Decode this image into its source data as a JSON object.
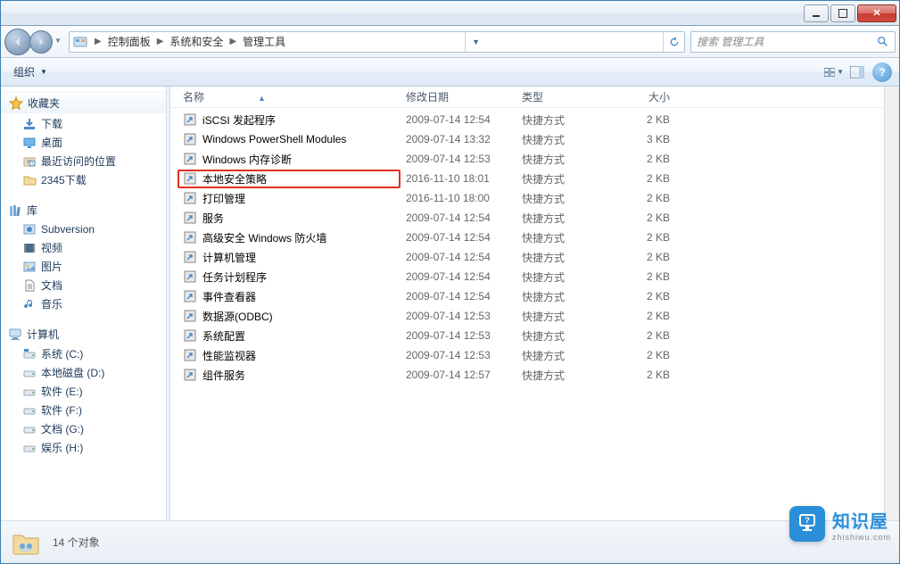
{
  "breadcrumb": {
    "items": [
      "控制面板",
      "系统和安全",
      "管理工具"
    ]
  },
  "search": {
    "placeholder": "搜索 管理工具"
  },
  "toolbar": {
    "organize": "组织"
  },
  "sidebar": {
    "favorites": {
      "label": "收藏夹",
      "items": [
        {
          "label": "下载",
          "icon": "download"
        },
        {
          "label": "桌面",
          "icon": "desktop"
        },
        {
          "label": "最近访问的位置",
          "icon": "recent"
        },
        {
          "label": "2345下载",
          "icon": "folder"
        }
      ]
    },
    "libraries": {
      "label": "库",
      "items": [
        {
          "label": "Subversion",
          "icon": "svn"
        },
        {
          "label": "视频",
          "icon": "video"
        },
        {
          "label": "图片",
          "icon": "picture"
        },
        {
          "label": "文档",
          "icon": "document"
        },
        {
          "label": "音乐",
          "icon": "music"
        }
      ]
    },
    "computer": {
      "label": "计算机",
      "items": [
        {
          "label": "系统 (C:)",
          "icon": "sysdrive"
        },
        {
          "label": "本地磁盘 (D:)",
          "icon": "drive"
        },
        {
          "label": "软件 (E:)",
          "icon": "drive"
        },
        {
          "label": "软件 (F:)",
          "icon": "drive"
        },
        {
          "label": "文档 (G:)",
          "icon": "drive"
        },
        {
          "label": "娱乐 (H:)",
          "icon": "drive"
        }
      ]
    }
  },
  "columns": {
    "name": "名称",
    "date": "修改日期",
    "type": "类型",
    "size": "大小"
  },
  "files": [
    {
      "name": "iSCSI 发起程序",
      "date": "2009-07-14 12:54",
      "type": "快捷方式",
      "size": "2 KB",
      "icon": "iscsi"
    },
    {
      "name": "Windows PowerShell Modules",
      "date": "2009-07-14 13:32",
      "type": "快捷方式",
      "size": "3 KB",
      "icon": "ps"
    },
    {
      "name": "Windows 内存诊断",
      "date": "2009-07-14 12:53",
      "type": "快捷方式",
      "size": "2 KB",
      "icon": "mem"
    },
    {
      "name": "本地安全策略",
      "date": "2016-11-10 18:01",
      "type": "快捷方式",
      "size": "2 KB",
      "icon": "secpol",
      "hl": true
    },
    {
      "name": "打印管理",
      "date": "2016-11-10 18:00",
      "type": "快捷方式",
      "size": "2 KB",
      "icon": "print"
    },
    {
      "name": "服务",
      "date": "2009-07-14 12:54",
      "type": "快捷方式",
      "size": "2 KB",
      "icon": "services"
    },
    {
      "name": "高级安全 Windows 防火墙",
      "date": "2009-07-14 12:54",
      "type": "快捷方式",
      "size": "2 KB",
      "icon": "firewall"
    },
    {
      "name": "计算机管理",
      "date": "2009-07-14 12:54",
      "type": "快捷方式",
      "size": "2 KB",
      "icon": "compmgmt"
    },
    {
      "name": "任务计划程序",
      "date": "2009-07-14 12:54",
      "type": "快捷方式",
      "size": "2 KB",
      "icon": "task"
    },
    {
      "name": "事件查看器",
      "date": "2009-07-14 12:54",
      "type": "快捷方式",
      "size": "2 KB",
      "icon": "eventvwr"
    },
    {
      "name": "数据源(ODBC)",
      "date": "2009-07-14 12:53",
      "type": "快捷方式",
      "size": "2 KB",
      "icon": "odbc"
    },
    {
      "name": "系统配置",
      "date": "2009-07-14 12:53",
      "type": "快捷方式",
      "size": "2 KB",
      "icon": "msconfig"
    },
    {
      "name": "性能监视器",
      "date": "2009-07-14 12:53",
      "type": "快捷方式",
      "size": "2 KB",
      "icon": "perfmon"
    },
    {
      "name": "组件服务",
      "date": "2009-07-14 12:57",
      "type": "快捷方式",
      "size": "2 KB",
      "icon": "comsvc"
    }
  ],
  "status": {
    "count": "14 个对象"
  },
  "watermark": {
    "badge": "?",
    "title": "知识屋",
    "sub": "zhishiwu.com"
  }
}
